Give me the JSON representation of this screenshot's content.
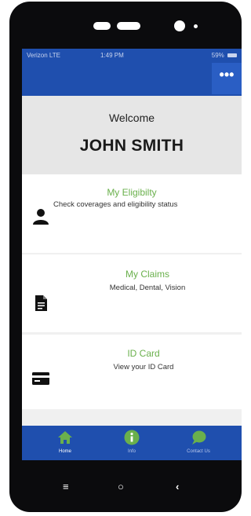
{
  "status_bar": {
    "carrier": "Verizon  LTE",
    "time": "1:49 PM",
    "battery": "59%"
  },
  "app_bar": {
    "menu_glyph": "•••",
    "color": "#1f4fae"
  },
  "welcome": {
    "label": "Welcome",
    "user_name": "JOHN SMITH"
  },
  "cards": [
    {
      "title": "My Eligibilty",
      "subtitle": "Check coverages and eligibility status",
      "icon": "person-icon"
    },
    {
      "title": "My Claims",
      "subtitle": "Medical, Dental, Vision",
      "icon": "document-icon"
    },
    {
      "title": "ID Card",
      "subtitle": "View your ID Card",
      "icon": "id-card-icon"
    }
  ],
  "bottom_nav": [
    {
      "label": "Home",
      "icon": "home-icon",
      "active": true
    },
    {
      "label": "Info",
      "icon": "info-icon",
      "active": false
    },
    {
      "label": "Contact Us",
      "icon": "chat-icon",
      "active": false
    }
  ],
  "hardware_buttons": {
    "menu": "≡",
    "home": "○",
    "back": "‹"
  },
  "colors": {
    "accent_green": "#6ab04c",
    "primary_blue": "#1f4fae"
  }
}
